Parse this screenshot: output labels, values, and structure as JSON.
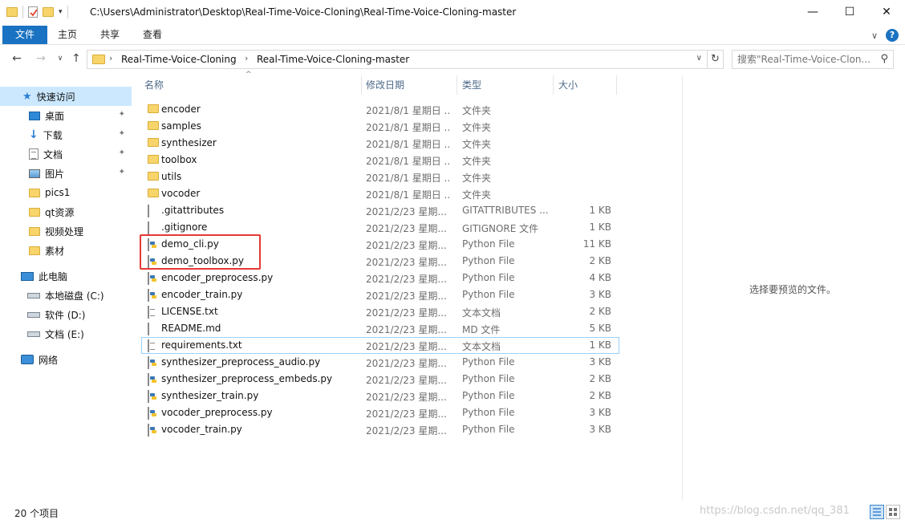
{
  "window": {
    "title_path": "C:\\Users\\Administrator\\Desktop\\Real-Time-Voice-Cloning\\Real-Time-Voice-Cloning-master",
    "minimize": "—",
    "maximize": "☐",
    "close": "✕"
  },
  "ribbon": {
    "tabs": [
      {
        "label": "文件"
      },
      {
        "label": "主页"
      },
      {
        "label": "共享"
      },
      {
        "label": "查看"
      }
    ],
    "expand": "∨",
    "help": "?"
  },
  "nav": {
    "back": "←",
    "forward": "→",
    "recent": "∨",
    "up": "↑",
    "breadcrumb": [
      "Real-Time-Voice-Cloning",
      "Real-Time-Voice-Cloning-master"
    ],
    "sep": "›",
    "dropdown": "∨",
    "refresh": "↻",
    "search_placeholder": "搜索\"Real-Time-Voice-Clon...",
    "search_icon": "⚲"
  },
  "sidebar": {
    "items": [
      {
        "label": "快速访问",
        "icon": "star-icon",
        "pinned": false
      },
      {
        "label": "桌面",
        "icon": "desktop-icon",
        "pinned": true
      },
      {
        "label": "下载",
        "icon": "download-icon",
        "pinned": true
      },
      {
        "label": "文档",
        "icon": "document-icon",
        "pinned": true
      },
      {
        "label": "图片",
        "icon": "picture-icon",
        "pinned": true
      },
      {
        "label": "pics1",
        "icon": "folder-icon",
        "pinned": false
      },
      {
        "label": "qt资源",
        "icon": "folder-icon",
        "pinned": false
      },
      {
        "label": "视频处理",
        "icon": "folder-icon",
        "pinned": false
      },
      {
        "label": "素材",
        "icon": "folder-icon",
        "pinned": false
      },
      {
        "label": "此电脑",
        "icon": "computer-icon",
        "pinned": false
      },
      {
        "label": "本地磁盘 (C:)",
        "icon": "drive-icon",
        "pinned": false
      },
      {
        "label": "软件 (D:)",
        "icon": "drive-icon",
        "pinned": false
      },
      {
        "label": "文档 (E:)",
        "icon": "drive-icon",
        "pinned": false
      },
      {
        "label": "网络",
        "icon": "network-icon",
        "pinned": false
      }
    ],
    "pin_glyph": "✦"
  },
  "columns": {
    "name": "名称",
    "date": "修改日期",
    "type": "类型",
    "size": "大小",
    "sort_arrow": "^"
  },
  "files": [
    {
      "name": "encoder",
      "date": "2021/8/1 星期日 ...",
      "type": "文件夹",
      "size": "",
      "kind": "folder"
    },
    {
      "name": "samples",
      "date": "2021/8/1 星期日 ...",
      "type": "文件夹",
      "size": "",
      "kind": "folder"
    },
    {
      "name": "synthesizer",
      "date": "2021/8/1 星期日 ...",
      "type": "文件夹",
      "size": "",
      "kind": "folder"
    },
    {
      "name": "toolbox",
      "date": "2021/8/1 星期日 ...",
      "type": "文件夹",
      "size": "",
      "kind": "folder"
    },
    {
      "name": "utils",
      "date": "2021/8/1 星期日 ...",
      "type": "文件夹",
      "size": "",
      "kind": "folder"
    },
    {
      "name": "vocoder",
      "date": "2021/8/1 星期日 ...",
      "type": "文件夹",
      "size": "",
      "kind": "folder"
    },
    {
      "name": ".gitattributes",
      "date": "2021/2/23 星期...",
      "type": "GITATTRIBUTES ...",
      "size": "1 KB",
      "kind": "doc"
    },
    {
      "name": ".gitignore",
      "date": "2021/2/23 星期...",
      "type": "GITIGNORE 文件",
      "size": "1 KB",
      "kind": "doc"
    },
    {
      "name": "demo_cli.py",
      "date": "2021/2/23 星期...",
      "type": "Python File",
      "size": "11 KB",
      "kind": "py"
    },
    {
      "name": "demo_toolbox.py",
      "date": "2021/2/23 星期...",
      "type": "Python File",
      "size": "2 KB",
      "kind": "py"
    },
    {
      "name": "encoder_preprocess.py",
      "date": "2021/2/23 星期...",
      "type": "Python File",
      "size": "4 KB",
      "kind": "py"
    },
    {
      "name": "encoder_train.py",
      "date": "2021/2/23 星期...",
      "type": "Python File",
      "size": "3 KB",
      "kind": "py"
    },
    {
      "name": "LICENSE.txt",
      "date": "2021/2/23 星期...",
      "type": "文本文档",
      "size": "2 KB",
      "kind": "txt"
    },
    {
      "name": "README.md",
      "date": "2021/2/23 星期...",
      "type": "MD 文件",
      "size": "5 KB",
      "kind": "doc"
    },
    {
      "name": "requirements.txt",
      "date": "2021/2/23 星期...",
      "type": "文本文档",
      "size": "1 KB",
      "kind": "txt"
    },
    {
      "name": "synthesizer_preprocess_audio.py",
      "date": "2021/2/23 星期...",
      "type": "Python File",
      "size": "3 KB",
      "kind": "py"
    },
    {
      "name": "synthesizer_preprocess_embeds.py",
      "date": "2021/2/23 星期...",
      "type": "Python File",
      "size": "2 KB",
      "kind": "py"
    },
    {
      "name": "synthesizer_train.py",
      "date": "2021/2/23 星期...",
      "type": "Python File",
      "size": "2 KB",
      "kind": "py"
    },
    {
      "name": "vocoder_preprocess.py",
      "date": "2021/2/23 星期...",
      "type": "Python File",
      "size": "3 KB",
      "kind": "py"
    },
    {
      "name": "vocoder_train.py",
      "date": "2021/2/23 星期...",
      "type": "Python File",
      "size": "3 KB",
      "kind": "py"
    }
  ],
  "preview": {
    "message": "选择要预览的文件。"
  },
  "status": {
    "count": "20 个项目",
    "watermark": "https://blog.csdn.net/qq_381"
  },
  "colors": {
    "accent": "#1a73c2",
    "selection": "#cce8ff",
    "highlight_box": "#e53935"
  }
}
